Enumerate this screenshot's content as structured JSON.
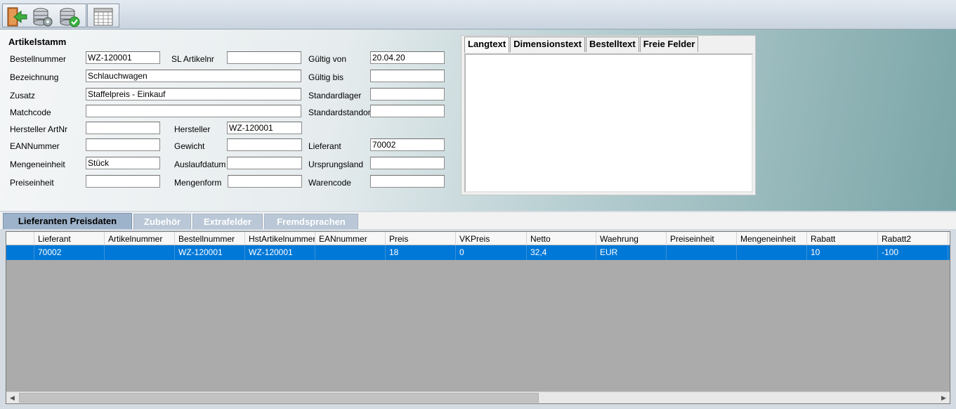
{
  "toolbar": {
    "buttons": [
      {
        "name": "exit-door-icon"
      },
      {
        "name": "database-settings-icon"
      },
      {
        "name": "database-check-icon"
      },
      {
        "name": "calendar-grid-icon"
      }
    ]
  },
  "form": {
    "title": "Artikelstamm",
    "labels": {
      "bestellnummer": "Bestellnummer",
      "bezeichnung": "Bezeichnung",
      "zusatz": "Zusatz",
      "matchcode": "Matchcode",
      "hersteller_artnr": "Hersteller ArtNr",
      "eannummer": "EANNummer",
      "mengeneinheit": "Mengeneinheit",
      "preiseinheit": "Preiseinheit",
      "sl_artikelnr": "SL Artikelnr",
      "hersteller": "Hersteller",
      "gewicht": "Gewicht",
      "auslaufdatum": "Auslaufdatum",
      "mengenform": "Mengenform",
      "gueltig_von": "Gültig von",
      "gueltig_bis": "Gültig bis",
      "standardlager": "Standardlager",
      "standardstandort": "Standardstandort",
      "lieferant": "Lieferant",
      "ursprungsland": "Ursprungsland",
      "warencode": "Warencode"
    },
    "values": {
      "bestellnummer": "WZ-120001",
      "bezeichnung": "Schlauchwagen",
      "zusatz": "Staffelpreis - Einkauf",
      "matchcode": "",
      "hersteller_artnr": "",
      "eannummer": "",
      "mengeneinheit": "Stück",
      "preiseinheit": "",
      "sl_artikelnr": "",
      "hersteller": "WZ-120001",
      "gewicht": "",
      "auslaufdatum": "",
      "mengenform": "",
      "gueltig_von": "20.04.20",
      "gueltig_bis": "",
      "standardlager": "",
      "standardstandort": "",
      "lieferant": "70002",
      "ursprungsland": "",
      "warencode": ""
    }
  },
  "text_tabs": [
    "Langtext",
    "Dimensionstext",
    "Bestelltext",
    "Freie Felder"
  ],
  "bottom_tabs": [
    "Lieferanten Preisdaten",
    "Zubehör",
    "Extrafelder",
    "Fremdsprachen"
  ],
  "grid": {
    "columns": [
      "Lieferant",
      "Artikelnummer",
      "Bestellnummer",
      "HstArtikelnummer",
      "EANnummer",
      "Preis",
      "VKPreis",
      "Netto",
      "Waehrung",
      "Preiseinheit",
      "Mengeneinheit",
      "Rabatt",
      "Rabatt2"
    ],
    "rows": [
      [
        "70002",
        "",
        "WZ-120001",
        "WZ-120001",
        "",
        "18",
        "0",
        "32,4",
        "EUR",
        "",
        "",
        "10",
        "-100"
      ]
    ]
  },
  "colors": {
    "selection": "#0078d7",
    "active_tab": "#9db3cb",
    "inactive_tab": "#b9c7d6"
  }
}
